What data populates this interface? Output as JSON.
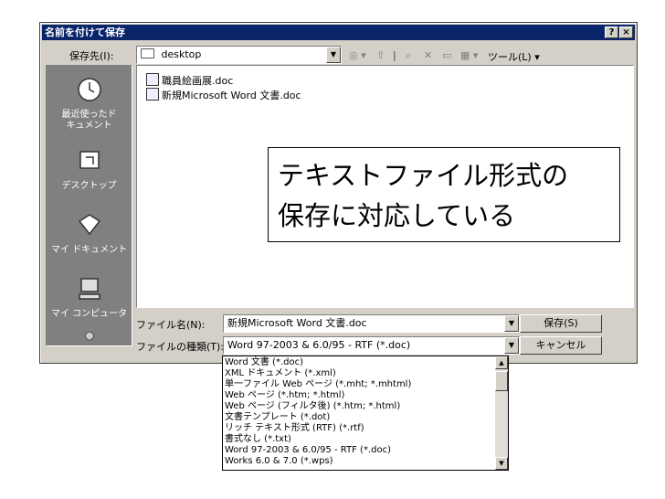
{
  "dialog": {
    "title": "名前を付けて保存",
    "help_button": "?",
    "close_button": "×"
  },
  "save_in": {
    "label": "保存先(I):",
    "value": "desktop",
    "toolbar_tools_label": "ツール(L)"
  },
  "places": [
    {
      "label": "最近使ったドキュメント"
    },
    {
      "label": "デスクトップ"
    },
    {
      "label": "マイ ドキュメント"
    },
    {
      "label": "マイ コンピュータ"
    },
    {
      "label": ""
    }
  ],
  "files": [
    {
      "name": "職員絵画展.doc"
    },
    {
      "name": "新規Microsoft Word 文書.doc"
    }
  ],
  "filename": {
    "label": "ファイル名(N):",
    "value": "新規Microsoft Word 文書.doc"
  },
  "filetype": {
    "label": "ファイルの種類(T):",
    "value": "Word 97-2003 & 6.0/95 - RTF (*.doc)",
    "options": [
      "Word 文書 (*.doc)",
      "XML ドキュメント (*.xml)",
      "単一ファイル Web ページ (*.mht; *.mhtml)",
      "Web ページ (*.htm; *.html)",
      "Web ページ (フィルタ後) (*.htm; *.html)",
      "文書テンプレート (*.dot)",
      "リッチ テキスト形式 (RTF) (*.rtf)",
      "書式なし (*.txt)",
      "Word 97-2003 & 6.0/95 - RTF (*.doc)",
      "Works 6.0 & 7.0 (*.wps)"
    ]
  },
  "buttons": {
    "save": "保存(S)",
    "cancel": "キャンセル"
  },
  "callout": {
    "line1": "テキストファイル形式の",
    "line2": "保存に対応している"
  }
}
